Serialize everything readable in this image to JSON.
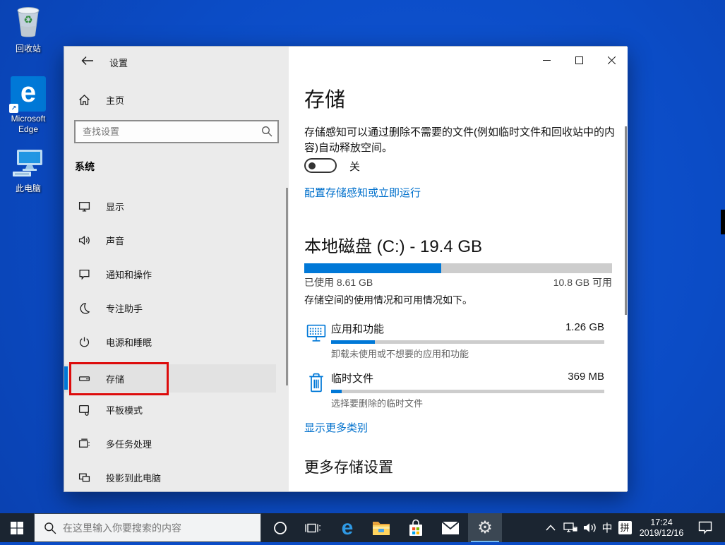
{
  "desktop": {
    "icons": [
      {
        "name": "recycle-bin",
        "label": "回收站"
      },
      {
        "name": "microsoft-edge",
        "label": "Microsoft Edge"
      },
      {
        "name": "this-pc",
        "label": "此电脑"
      }
    ]
  },
  "window": {
    "title": "设置",
    "sidebar": {
      "home_label": "主页",
      "search_placeholder": "查找设置",
      "section_label": "系统",
      "items": [
        {
          "label": "显示",
          "icon": "display-icon"
        },
        {
          "label": "声音",
          "icon": "sound-icon"
        },
        {
          "label": "通知和操作",
          "icon": "notifications-icon"
        },
        {
          "label": "专注助手",
          "icon": "focus-assist-icon"
        },
        {
          "label": "电源和睡眠",
          "icon": "power-sleep-icon"
        },
        {
          "label": "存储",
          "icon": "storage-icon",
          "selected": true,
          "annotated": "red-box"
        },
        {
          "label": "平板模式",
          "icon": "tablet-mode-icon"
        },
        {
          "label": "多任务处理",
          "icon": "multitasking-icon"
        },
        {
          "label": "投影到此电脑",
          "icon": "project-icon"
        }
      ]
    },
    "content": {
      "page_title": "存储",
      "description": "存储感知可以通过删除不需要的文件(例如临时文件和回收站中的内容)自动释放空间。",
      "toggle_state": "关",
      "configure_link": "配置存储感知或立即运行",
      "disk": {
        "title": "本地磁盘 (C:) - 19.4 GB",
        "used_label": "已使用 8.61 GB",
        "free_label": "10.8 GB 可用",
        "used_percent": 44.4,
        "note": "存储空间的使用情况和可用情况如下。"
      },
      "categories": [
        {
          "label": "应用和功能",
          "value": "1.26 GB",
          "desc": "卸载未使用或不想要的应用和功能",
          "percent": 16,
          "icon": "apps-features-icon"
        },
        {
          "label": "临时文件",
          "value": "369 MB",
          "desc": "选择要删除的临时文件",
          "percent": 4,
          "icon": "temp-files-trash-icon"
        }
      ],
      "more_categories_link": "显示更多类别",
      "more_settings_title": "更多存储设置"
    }
  },
  "taskbar": {
    "search_placeholder": "在这里输入你要搜索的内容",
    "ime_lang": "中",
    "ime_pinyin": "拼",
    "clock_time": "17:24",
    "clock_date": "2019/12/16"
  },
  "colors": {
    "accent": "#0078d7",
    "annotation_red": "#dd0b0b",
    "desktop_blue": "#0b4cc6",
    "taskbar_bg": "#1b2531",
    "link_blue": "#0070cc"
  }
}
